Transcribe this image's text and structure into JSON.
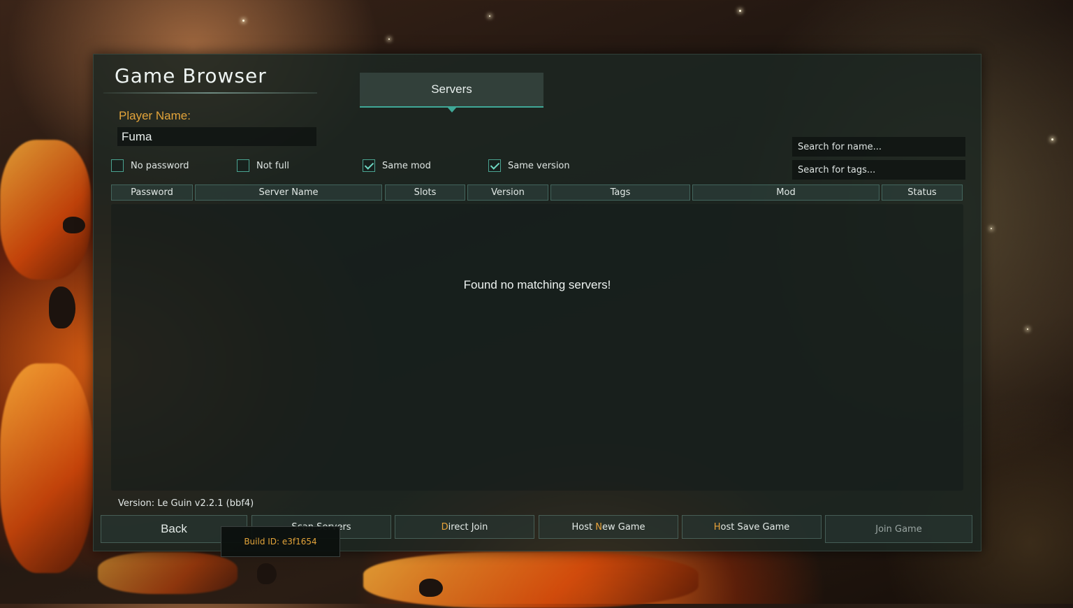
{
  "window": {
    "title": "Game Browser"
  },
  "tabs": [
    {
      "label": "Servers"
    }
  ],
  "player": {
    "label": "Player Name:",
    "value": "Fuma"
  },
  "search": {
    "name_placeholder": "Search for name...",
    "tags_placeholder": "Search for tags..."
  },
  "filters": [
    {
      "label": "No password",
      "checked": false
    },
    {
      "label": "Not full",
      "checked": false
    },
    {
      "label": "Same mod",
      "checked": true
    },
    {
      "label": "Same version",
      "checked": true
    }
  ],
  "table": {
    "columns": [
      "Password",
      "Server Name",
      "Slots",
      "Version",
      "Tags",
      "Mod",
      "Status"
    ],
    "rows": [],
    "empty_message": "Found no matching servers!"
  },
  "version_text": "Version: Le Guin v2.2.1 (bbf4)",
  "buttons": {
    "back": "Back",
    "scan_servers": "Scan Servers",
    "direct_join_hot": "D",
    "direct_join_rest": "irect Join",
    "host_new_pre": "Host ",
    "host_new_hot": "N",
    "host_new_rest": "ew Game",
    "host_save_hot": "H",
    "host_save_rest": "ost Save Game",
    "join_game": "Join Game"
  },
  "tooltip": {
    "text": "Build ID: e3f1654"
  },
  "colors": {
    "accent": "#3fa897",
    "highlight": "#e3a43a",
    "panel": "#1c2622"
  }
}
